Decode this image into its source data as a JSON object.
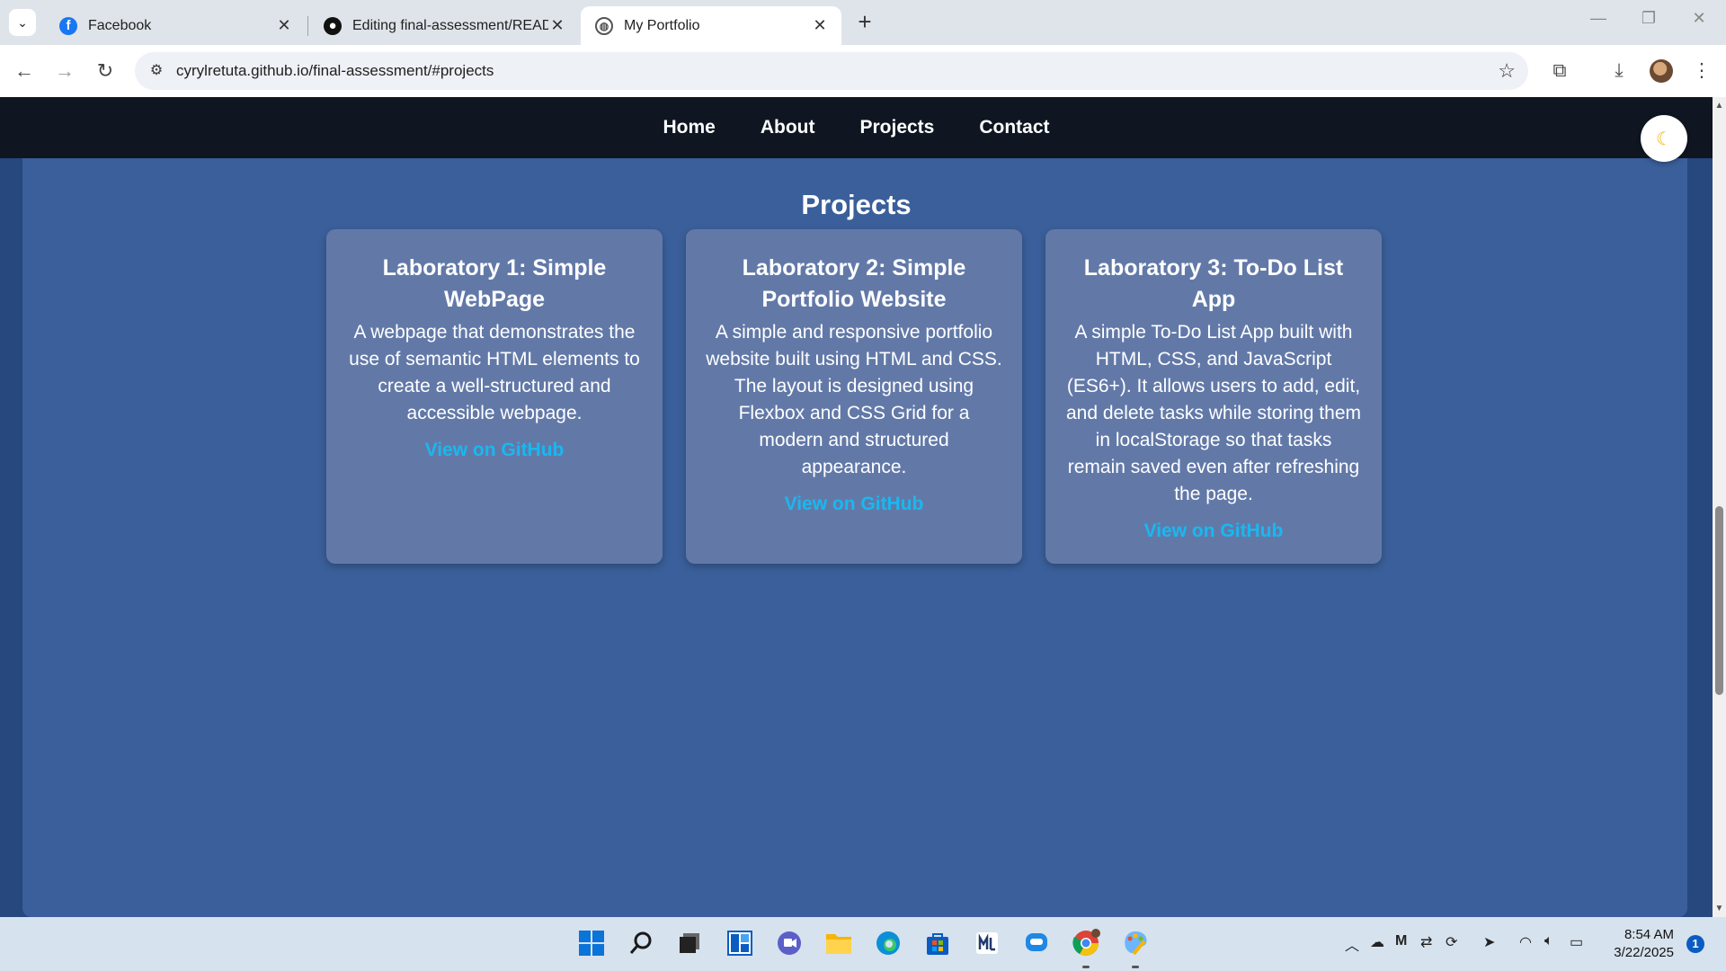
{
  "browser": {
    "tabs": [
      {
        "title": "Facebook",
        "icon": "facebook-icon",
        "color": "#1877f2",
        "active": false
      },
      {
        "title": "Editing final-assessment/README",
        "icon": "github-icon",
        "color": "#111111",
        "active": false
      },
      {
        "title": "My Portfolio",
        "icon": "globe-icon",
        "color": "#555555",
        "active": true
      }
    ],
    "url": "cyrylretuta.github.io/final-assessment/#projects"
  },
  "site": {
    "nav": {
      "home": "Home",
      "about": "About",
      "projects": "Projects",
      "contact": "Contact"
    },
    "theme_toggle_icon": "moon-icon",
    "section_title": "Projects",
    "projects": [
      {
        "title": "Laboratory 1: Simple WebPage",
        "description": "A webpage that demonstrates the use of semantic HTML elements to create a well-structured and accessible webpage.",
        "link": "View on GitHub"
      },
      {
        "title": "Laboratory 2: Simple Portfolio Website",
        "description": "A simple and responsive portfolio website built using HTML and CSS. The layout is designed using Flexbox and CSS Grid for a modern and structured appearance.",
        "link": "View on GitHub"
      },
      {
        "title": "Laboratory 3: To-Do List App",
        "description": "A simple To-Do List App built with HTML, CSS, and JavaScript (ES6+). It allows users to add, edit, and delete tasks while storing them in localStorage so that tasks remain saved even after refreshing the page.",
        "link": "View on GitHub"
      }
    ],
    "colors": {
      "nav_bg": "#0f1622",
      "page_bg": "#3a5f9a",
      "card_bg": "#6279a8",
      "link": "#19b8f0"
    }
  },
  "taskbar": {
    "apps": [
      "windows-start-icon",
      "search-icon",
      "task-view-icon",
      "widgets-icon",
      "teams-icon",
      "file-explorer-icon",
      "edge-icon",
      "store-icon",
      "app-icon",
      "chat-icon",
      "chrome-icon",
      "paint-icon"
    ],
    "time": "8:54 AM",
    "date": "3/22/2025",
    "notifications": "1"
  }
}
